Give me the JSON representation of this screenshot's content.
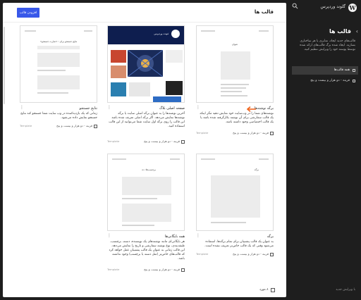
{
  "sidebar": {
    "site_name": "گلوند وردپرس",
    "logo_glyph": "W",
    "back_glyph": "‹",
    "title": "قالب ها",
    "description": "قالب‌های جدید ایجاد، تمایزی یا هر ساختاری بسازید. ایجاد شده برگ قالب‌های ارائه شده توسط پوسته خود را ویرایش تنظیم کنید.",
    "items": [
      {
        "label": "همه قالب‌ها",
        "active": true
      },
      {
        "label": "قرینه - دو هزار و بیست و پنج",
        "active": false
      }
    ],
    "footer": "با ویرایش جدید"
  },
  "header": {
    "title": "قالب ها",
    "add_button": "افزودن قالب"
  },
  "cards": [
    {
      "title": "برگه نوشته‌ها",
      "description": "نوشته‌های شما را در وب‌سایت خود نمایش دهید مگر اینکه یک قالب سفارشی برای آن نوشته بکارگرفته شده باشد یا یک قالب اختصاصی وجود داشته باشد.",
      "source": "قرینه - دو هزار و بیست و پنج",
      "tag": "Template",
      "thumb_text": "عنوان"
    },
    {
      "title": "صفحه اصلی بلاگ",
      "description": "آخرین نوشته‌ها را به عنوان برگه اصلی سایت یا برگه نوشته‌ها نمایش می‌دهد. اگر برگه اصلی تعریف شده باشد این قالب را روی برگه اول سایت شما می‌توانید از این قالب استفاده کنید.",
      "source": "قرینه - دو هزار و بیست و پنج",
      "tag": "Template",
      "thumb_title": "فونت وردپرس"
    },
    {
      "title": "نتایج جستجو",
      "description": "زمانی که یک بازدیدکننده در وب سایت شما جستجو کند نتایج جستجو نمایش داده می‌شود.",
      "source": "قرینه - دو هزار و بیست و پنج",
      "tag": "Template",
      "thumb_text": "نتایج جستجو برای : «عبارت جستجو»"
    },
    {
      "title": "برگه",
      "description": "به عنوان یک قالب پشتیبان برای تمام برگه‌ها، استفاده می‌شود وقتی که یک قالب خاص‌تر تعریف نشده است.",
      "source": "قرینه - دو هزار و بیست و پنج",
      "tag": "Template",
      "thumb_text": "برگه"
    },
    {
      "title": "همه بایگانی‌ها",
      "description": "هر بایگانی‌ای مانند نوشته‌های یک نویسنده، دسته، برچسب، طبقه‌بندی، نوع نوشته سفارشی و تاریخ را نمایش می‌دهد. این قالب زمانی به عنوان یک قالب پشتیبان عمل خواهد کرد که قالب‌های خاص‌تر (مثل دسته یا برچسب) وجود نداشته باشد.",
      "source": "قرینه - دو هزار و بیست و پنج",
      "tag": "Template",
      "thumb_text": "برچسب‌ها: ده"
    }
  ],
  "footer": {
    "label": "۸ مورد"
  },
  "colors": {
    "accent": "#3858e9",
    "dark_bg": "#1e1e1e",
    "arrow": "#f0661f"
  }
}
